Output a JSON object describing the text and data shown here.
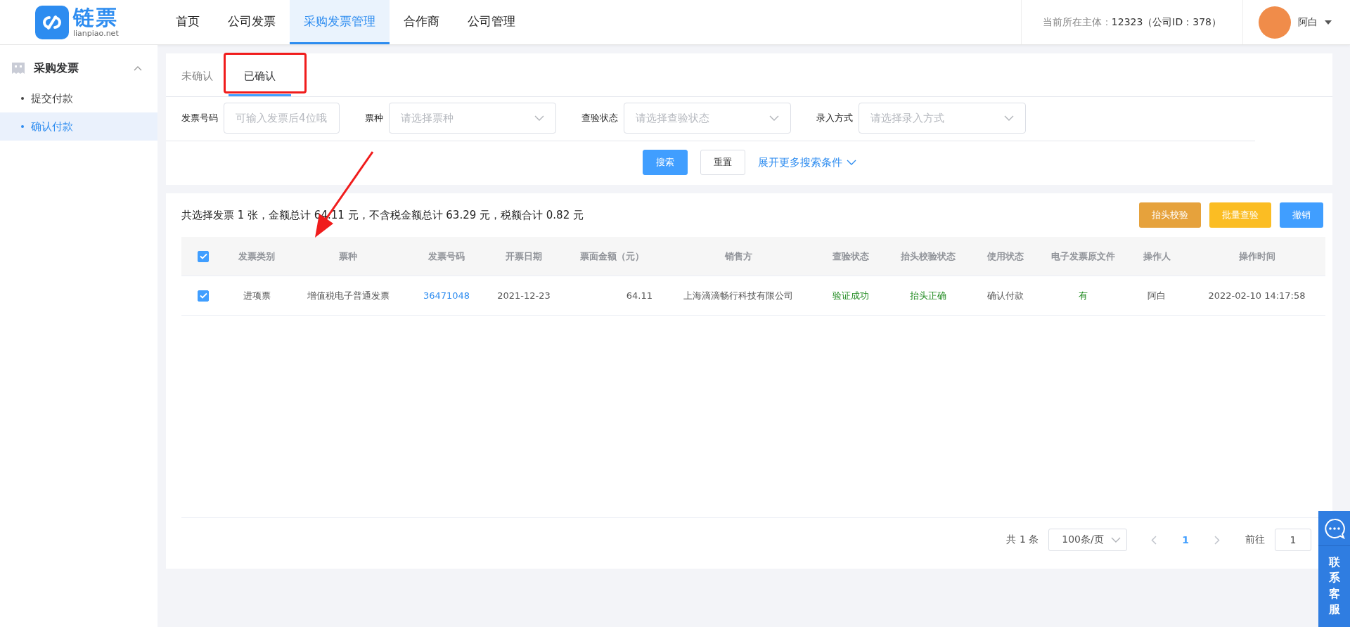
{
  "header": {
    "logo": {
      "name": "链票",
      "domain": "lianpiao.net"
    },
    "nav": [
      {
        "label": "首页",
        "selected": false
      },
      {
        "label": "公司发票",
        "selected": false
      },
      {
        "label": "采购发票管理",
        "selected": true
      },
      {
        "label": "合作商",
        "selected": false
      },
      {
        "label": "公司管理",
        "selected": false
      }
    ],
    "entity_label": "当前所在主体：",
    "entity_value": "12323（公司ID：378）",
    "user": "阿白"
  },
  "sidebar": {
    "group": {
      "label": "采购发票",
      "expanded": true,
      "items": [
        {
          "label": "提交付款",
          "selected": false
        },
        {
          "label": "确认付款",
          "selected": true
        }
      ]
    }
  },
  "tabs": [
    {
      "label": "未确认",
      "selected": false
    },
    {
      "label": "已确认",
      "selected": true
    }
  ],
  "filters": [
    {
      "label": "发票号码",
      "kind": "input",
      "placeholder": "可输入发票后4位哦"
    },
    {
      "label": "票种",
      "kind": "select",
      "placeholder": "请选择票种"
    },
    {
      "label": "查验状态",
      "kind": "select",
      "placeholder": "请选择查验状态"
    },
    {
      "label": "录入方式",
      "kind": "select",
      "placeholder": "请选择录入方式"
    }
  ],
  "search_buttons": {
    "search": "搜索",
    "reset": "重置",
    "expand": "展开更多搜索条件"
  },
  "summary": "共选择发票 1 张，金额总计 64.11 元，不含税金额总计 63.29 元，税额合计 0.82 元",
  "actions": [
    {
      "label": "抬头校验",
      "color": "#e6a23c"
    },
    {
      "label": "批量查验",
      "color": "#fbbd23"
    },
    {
      "label": "撤销",
      "color": "#409eff"
    }
  ],
  "table": {
    "all_checked": true,
    "columns": [
      "发票类别",
      "票种",
      "发票号码",
      "开票日期",
      "票面金额（元）",
      "销售方",
      "查验状态",
      "抬头校验状态",
      "使用状态",
      "电子发票原文件",
      "操作人",
      "操作时间"
    ],
    "rows": [
      {
        "checked": true,
        "cells": [
          {
            "text": "进项票",
            "kind": "text"
          },
          {
            "text": "增值税电子普通发票",
            "kind": "text"
          },
          {
            "text": "36471048",
            "kind": "link"
          },
          {
            "text": "2021-12-23",
            "kind": "text"
          },
          {
            "text": "64.11",
            "kind": "amount"
          },
          {
            "text": "上海滴滴畅行科技有限公司",
            "kind": "text"
          },
          {
            "text": "验证成功",
            "kind": "success"
          },
          {
            "text": "抬头正确",
            "kind": "success"
          },
          {
            "text": "确认付款",
            "kind": "text"
          },
          {
            "text": "有",
            "kind": "success"
          },
          {
            "text": "阿白",
            "kind": "text"
          },
          {
            "text": "2022-02-10 14:17:58",
            "kind": "text"
          }
        ]
      }
    ]
  },
  "pagination": {
    "total": "共 1 条",
    "page_size": "100条/页",
    "pages": [
      {
        "label": "1",
        "selected": true
      }
    ],
    "goto_label": "前往",
    "goto_value": "1"
  },
  "support_widget": {
    "label": "联系客服"
  }
}
